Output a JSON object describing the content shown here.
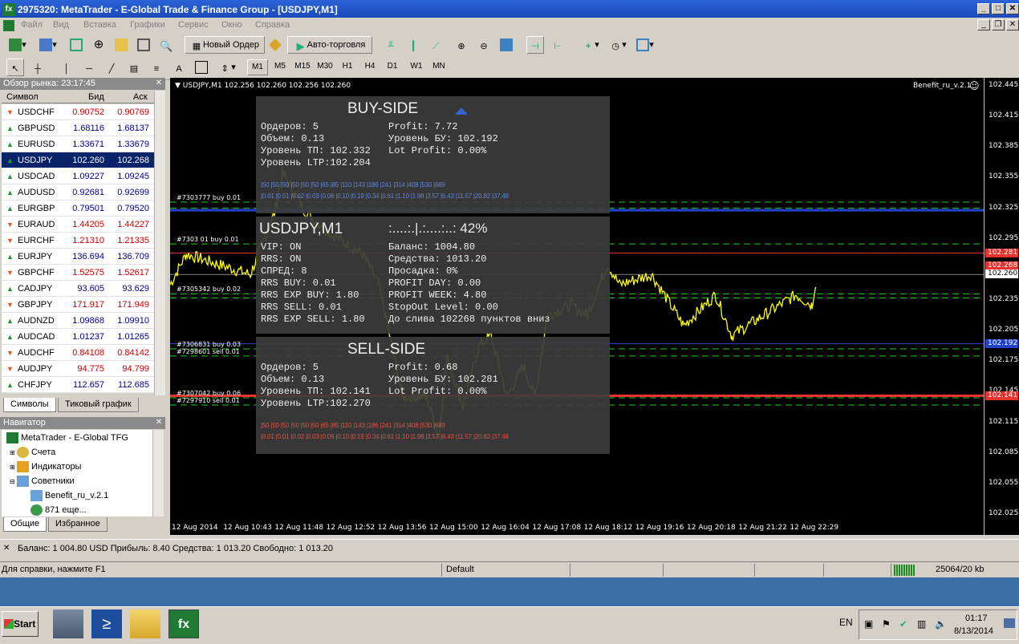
{
  "window": {
    "title": "2975320: MetaTrader - E-Global Trade & Finance Group - [USDJPY,M1]",
    "icon_text": "fx"
  },
  "menu": [
    "Файл",
    "Вид",
    "Вставка",
    "Графики",
    "Сервис",
    "Окно",
    "Справка"
  ],
  "toolbar": {
    "new_order": "Новый Ордер",
    "auto_trading": "Авто-торговля"
  },
  "toolbar2": {
    "draw_text": "A"
  },
  "timeframes": [
    "M1",
    "M5",
    "M15",
    "M30",
    "H1",
    "H4",
    "D1",
    "W1",
    "MN"
  ],
  "active_timeframe": "M1",
  "market_watch": {
    "title": "Обзор рынка: 23:17:45",
    "headers": {
      "symbol": "Символ",
      "bid": "Бид",
      "ask": "Аск"
    },
    "rows": [
      {
        "symbol": "USDCHF",
        "bid": "0.90752",
        "ask": "0.90769",
        "dir": "down"
      },
      {
        "symbol": "GBPUSD",
        "bid": "1.68116",
        "ask": "1.68137",
        "dir": "up"
      },
      {
        "symbol": "EURUSD",
        "bid": "1.33671",
        "ask": "1.33679",
        "dir": "up"
      },
      {
        "symbol": "USDJPY",
        "bid": "102.260",
        "ask": "102.268",
        "dir": "up"
      },
      {
        "symbol": "USDCAD",
        "bid": "1.09227",
        "ask": "1.09245",
        "dir": "up"
      },
      {
        "symbol": "AUDUSD",
        "bid": "0.92681",
        "ask": "0.92699",
        "dir": "up"
      },
      {
        "symbol": "EURGBP",
        "bid": "0.79501",
        "ask": "0.79520",
        "dir": "up"
      },
      {
        "symbol": "EURAUD",
        "bid": "1.44205",
        "ask": "1.44227",
        "dir": "down"
      },
      {
        "symbol": "EURCHF",
        "bid": "1.21310",
        "ask": "1.21335",
        "dir": "down"
      },
      {
        "symbol": "EURJPY",
        "bid": "136.694",
        "ask": "136.709",
        "dir": "up"
      },
      {
        "symbol": "GBPCHF",
        "bid": "1.52575",
        "ask": "1.52617",
        "dir": "down"
      },
      {
        "symbol": "CADJPY",
        "bid": "93.605",
        "ask": "93.629",
        "dir": "up"
      },
      {
        "symbol": "GBPJPY",
        "bid": "171.917",
        "ask": "171.949",
        "dir": "down"
      },
      {
        "symbol": "AUDNZD",
        "bid": "1.09868",
        "ask": "1.09910",
        "dir": "up"
      },
      {
        "symbol": "AUDCAD",
        "bid": "1.01237",
        "ask": "1.01265",
        "dir": "up"
      },
      {
        "symbol": "AUDCHF",
        "bid": "0.84108",
        "ask": "0.84142",
        "dir": "down"
      },
      {
        "symbol": "AUDJPY",
        "bid": "94.775",
        "ask": "94.799",
        "dir": "down"
      },
      {
        "symbol": "CHFJPY",
        "bid": "112.657",
        "ask": "112.685",
        "dir": "up"
      }
    ],
    "tabs": [
      "Символы",
      "Тиковый график"
    ]
  },
  "navigator": {
    "title": "Навигатор",
    "items": [
      "MetaTrader - E-Global TFG",
      "Счета",
      "Индикаторы",
      "Советники",
      "Benefit_ru_v.2.1",
      "871 еще..."
    ],
    "tabs": [
      "Общие",
      "Избранное"
    ]
  },
  "chart": {
    "header": "USDJPY,M1  102.256 102.260 102.256 102.260",
    "expert": "Benefit_ru_v.2.1",
    "smiley": "☺",
    "price_labels": [
      "102.445",
      "102.415",
      "102.385",
      "102.355",
      "102.325",
      "102.295",
      "102.265",
      "102.235",
      "102.205",
      "102.175",
      "102.145",
      "102.115",
      "102.085",
      "102.055",
      "102.025"
    ],
    "price_tags": [
      {
        "text": "102.281",
        "bg": "#e8322d",
        "fg": "#ffffff",
        "price": 102.281
      },
      {
        "text": "102.268",
        "bg": "#e8322d",
        "fg": "#ffffff",
        "price": 102.268
      },
      {
        "text": "102.260",
        "bg": "#ffffff",
        "fg": "#000000",
        "price": 102.26
      },
      {
        "text": "102.192",
        "bg": "#2244cc",
        "fg": "#ffffff",
        "price": 102.192
      },
      {
        "text": "102.141",
        "bg": "#e8322d",
        "fg": "#ffffff",
        "price": 102.141
      }
    ],
    "time_labels": [
      "12 Aug 2014",
      "12 Aug 10:43",
      "12 Aug 11:48",
      "12 Aug 12:52",
      "12 Aug 13:56",
      "12 Aug 15:00",
      "12 Aug 16:04",
      "12 Aug 17:08",
      "12 Aug 18:12",
      "12 Aug 19:16",
      "12 Aug 20:18",
      "12 Aug 21:22",
      "12 Aug 22:29"
    ],
    "order_labels": [
      {
        "text": "#7303777 buy 0.01",
        "price": 102.331
      },
      {
        "text": "#7303 01 buy 0.01",
        "price": 102.29
      },
      {
        "text": "#7305342 buy 0.02",
        "price": 102.241
      },
      {
        "text": "#7306831 buy 0.03",
        "price": 102.187
      },
      {
        "text": "#7298601 sell 0.01",
        "price": 102.18
      },
      {
        "text": "#7307042 buy 0.06",
        "price": 102.139
      },
      {
        "text": "#7297910 sell 0.01",
        "price": 102.132
      }
    ]
  },
  "buy_panel": {
    "title": "BUY-SIDE",
    "left": [
      "Ордеров: 5",
      "Объем: 0.13",
      "Уровень ТП: 102.332",
      "Уровень LTP:102.204"
    ],
    "right": [
      "Profit: 7.72",
      "Уровень БУ: 102.192",
      "Lot Profit: 0.00%"
    ],
    "lot_row1": "|50      |50     |50      |50      |50      |50    |65     |85    |110   |143   |186   |241   |314   |408   |530   |689",
    "lot_row2": "|0.01   |0.01  |0.02  |0.03  |0.06  |0.10  |0.19  |0.34  |0.61  |1.10  |1.98  |3.57  |6.43  |11.57 |20.82 |37.48"
  },
  "info_panel": {
    "title": "USDJPY,M1",
    "progress_text": ":....:.|.:....:..: 42%",
    "left": [
      "VIP: ON",
      "RRS: ON",
      "СПРЕД: 8",
      "RRS BUY: 0.01",
      "RRS EXP BUY: 1.80",
      "RRS SELL: 0.01",
      "RRS EXP SELL: 1.80"
    ],
    "right": [
      "Баланс: 1004.80",
      "Средства: 1013.20",
      "Просадка: 0%",
      "PROFIT DAY: 0.00",
      "PROFIT WEEK: 4.80",
      "StopOut Level: 0.00",
      "До слива 102268 пунктов вниз"
    ]
  },
  "sell_panel": {
    "title": "SELL-SIDE",
    "left": [
      "Ордеров: 5",
      "Объем: 0.13",
      "Уровень ТП: 102.141",
      "Уровень LTP:102.270"
    ],
    "right": [
      "Profit: 0.68",
      "Уровень БУ: 102.281",
      "Lot Profit: 0.00%"
    ],
    "lot_row1": "|50      |50     |50      |50      |50      |50    |65     |85    |110   |143   |186   |241   |314   |408   |530   |689",
    "lot_row2": "|0.01   |0.01  |0.02  |0.03  |0.06  |0.10  |0.19  |0.34  |0.61  |1.10  |1.98  |3.57  |6.43  |11.57 |20.82 |37.48"
  },
  "balance_bar": {
    "text": "Баланс: 1 004.80 USD  Прибыль: 8.40  Средства: 1 013.20  Свободно: 1 013.20"
  },
  "status_bar": {
    "help": "Для справки, нажмите F1",
    "profile": "Default",
    "traffic": "25064/20 kb"
  },
  "taskbar": {
    "start": "Start",
    "lang": "EN",
    "time": "01:17",
    "date": "8/13/2014"
  },
  "colors": {
    "price_line": "#ffff00",
    "buy_line": "#2244cc",
    "sell_line": "#e8322d",
    "tp_dash": "#22cc22",
    "panel_bg": "#3c3c3c"
  }
}
